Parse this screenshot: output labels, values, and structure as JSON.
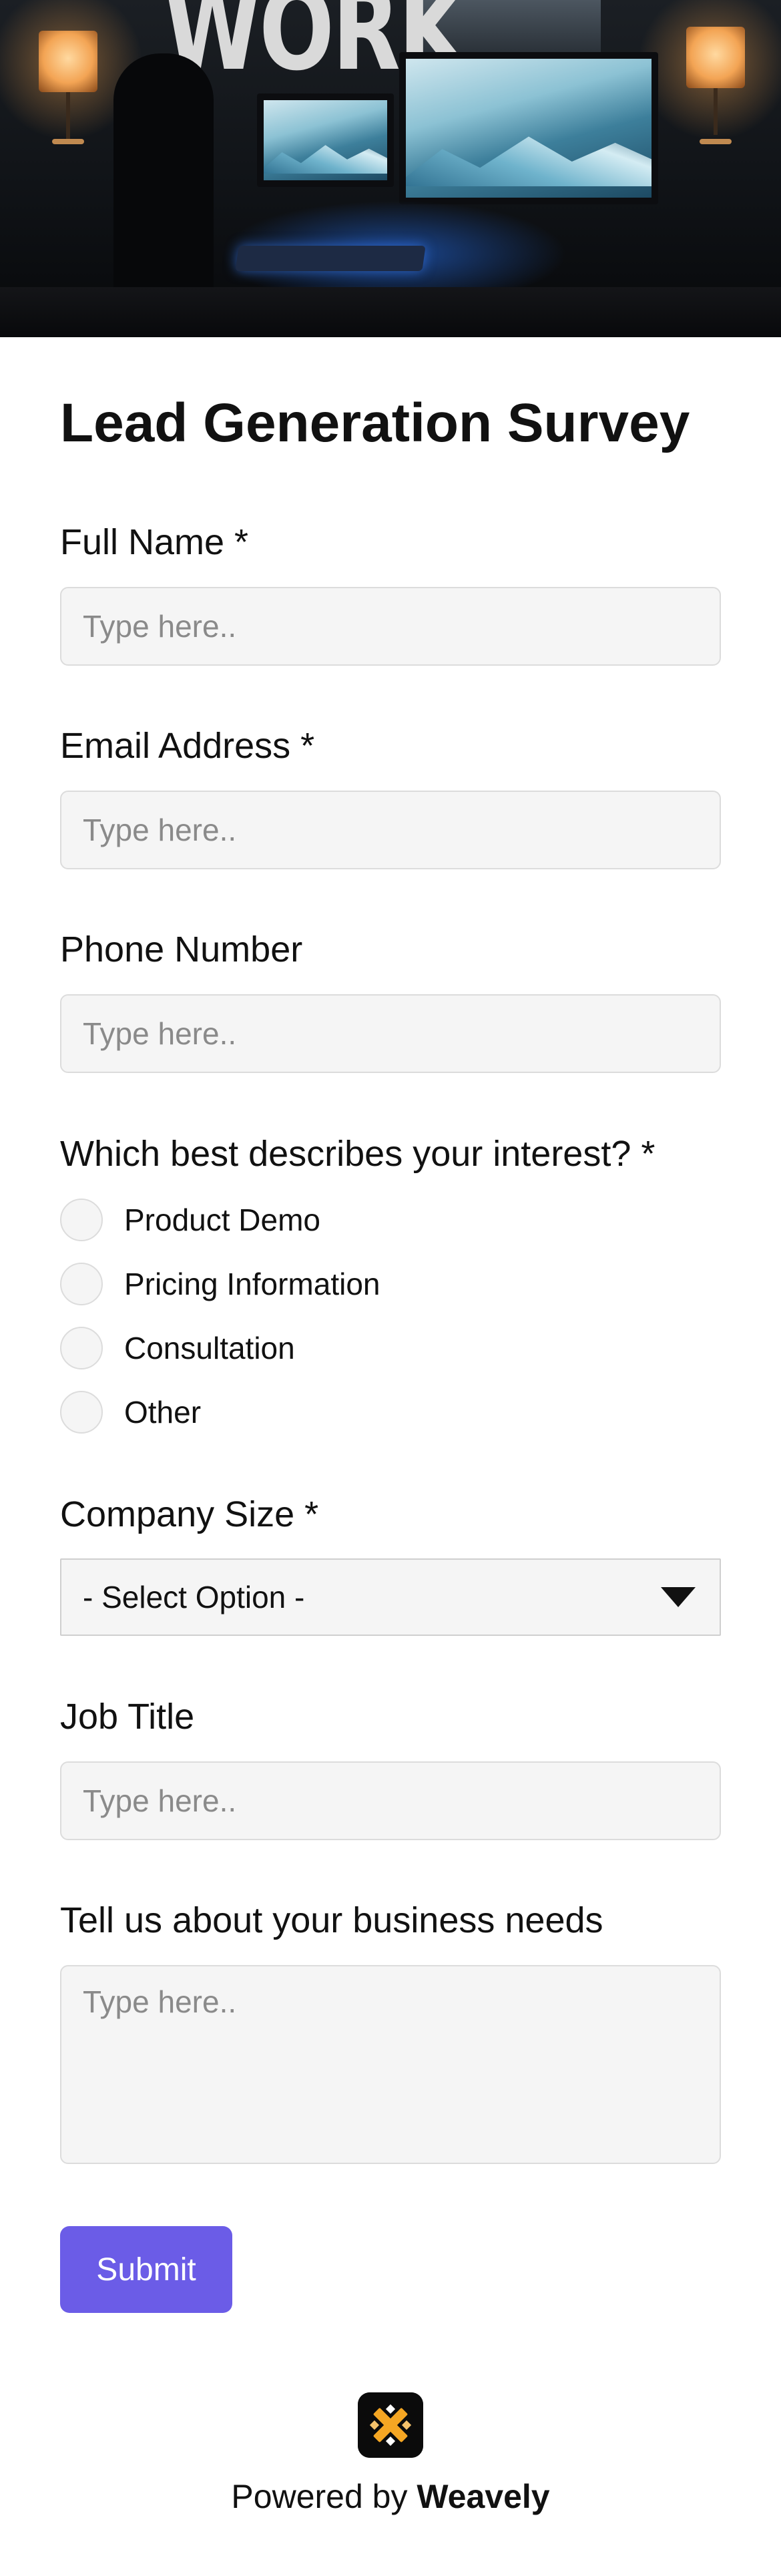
{
  "hero": {
    "sign_text": "WORK",
    "alt": "Workspace"
  },
  "form": {
    "title": "Lead Generation Survey",
    "fields": {
      "full_name": {
        "label": "Full Name *",
        "placeholder": "Type here..",
        "value": ""
      },
      "email": {
        "label": "Email Address *",
        "placeholder": "Type here..",
        "value": ""
      },
      "phone": {
        "label": "Phone Number",
        "placeholder": "Type here..",
        "value": ""
      },
      "interest": {
        "label": "Which best describes your interest? *",
        "options": [
          "Product Demo",
          "Pricing Information",
          "Consultation",
          "Other"
        ],
        "selected": null
      },
      "company_size": {
        "label": "Company Size *",
        "selected": "- Select Option -"
      },
      "job_title": {
        "label": "Job Title",
        "placeholder": "Type here..",
        "value": ""
      },
      "business_needs": {
        "label": "Tell us about your business needs",
        "placeholder": "Type here..",
        "value": ""
      }
    },
    "submit_label": "Submit"
  },
  "footer": {
    "prefix": "Powered by ",
    "brand": "Weavely",
    "logo_icon": "weavely-logo-icon"
  },
  "colors": {
    "accent": "#6b5ce7",
    "input_bg": "#f5f5f5",
    "input_border": "#dcdcdc",
    "text": "#111111",
    "placeholder": "#8a8a8a",
    "logo_orange": "#f5a623"
  }
}
